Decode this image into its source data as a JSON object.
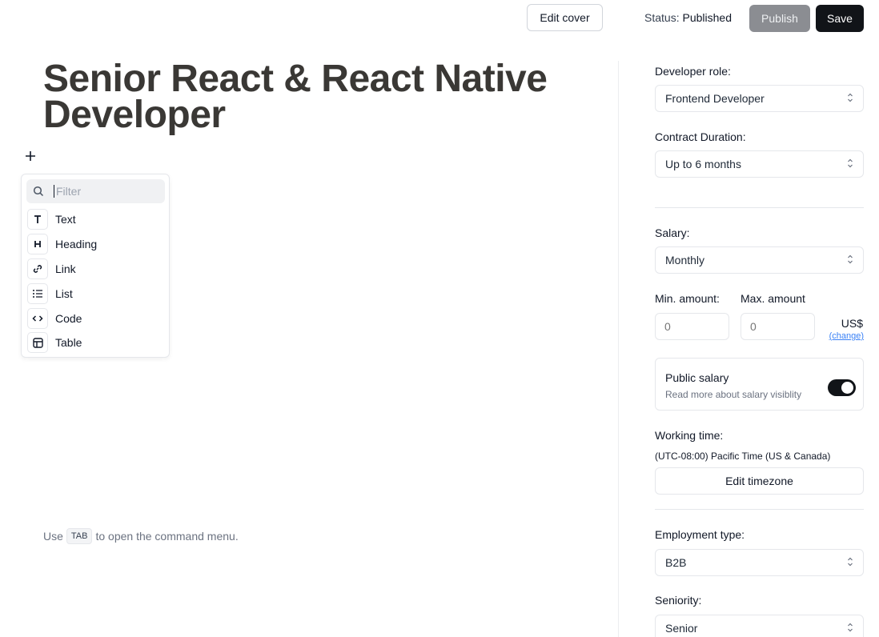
{
  "topbar": {
    "edit_cover_label": "Edit cover",
    "status_label": "Status:",
    "status_value": "Published",
    "publish_label": "Publish",
    "save_label": "Save"
  },
  "editor": {
    "title": "Senior React & React Native Developer",
    "hint_before": "Use",
    "hint_key": "TAB",
    "hint_after": "to open the command menu."
  },
  "command_menu": {
    "filter_placeholder": "Filter",
    "items": [
      {
        "label": "Text",
        "icon": "text-icon"
      },
      {
        "label": "Heading",
        "icon": "heading-icon"
      },
      {
        "label": "Link",
        "icon": "link-icon"
      },
      {
        "label": "List",
        "icon": "list-icon"
      },
      {
        "label": "Code",
        "icon": "code-icon"
      },
      {
        "label": "Table",
        "icon": "table-icon"
      }
    ]
  },
  "sidebar": {
    "developer_role": {
      "label": "Developer role:",
      "value": "Frontend Developer"
    },
    "contract_duration": {
      "label": "Contract Duration:",
      "value": "Up to 6 months"
    },
    "salary": {
      "label": "Salary:",
      "value": "Monthly"
    },
    "min_amount": {
      "label": "Min. amount:",
      "placeholder": "0"
    },
    "max_amount": {
      "label": "Max. amount",
      "placeholder": "0"
    },
    "currency": "US$",
    "change_label": "(change)",
    "public_salary": {
      "title": "Public salary",
      "subtitle": "Read more about salary visiblity",
      "enabled": true
    },
    "working_time": {
      "label": "Working time:",
      "timezone": "(UTC-08:00) Pacific Time (US & Canada)",
      "edit_label": "Edit timezone"
    },
    "employment_type": {
      "label": "Employment type:",
      "value": "B2B"
    },
    "seniority": {
      "label": "Seniority:",
      "value": "Senior"
    }
  },
  "colors": {
    "primary_dark": "#111418",
    "publish_disabled": "#8b8d92",
    "title_color": "#3a3835",
    "link_blue": "#3b82f6"
  }
}
